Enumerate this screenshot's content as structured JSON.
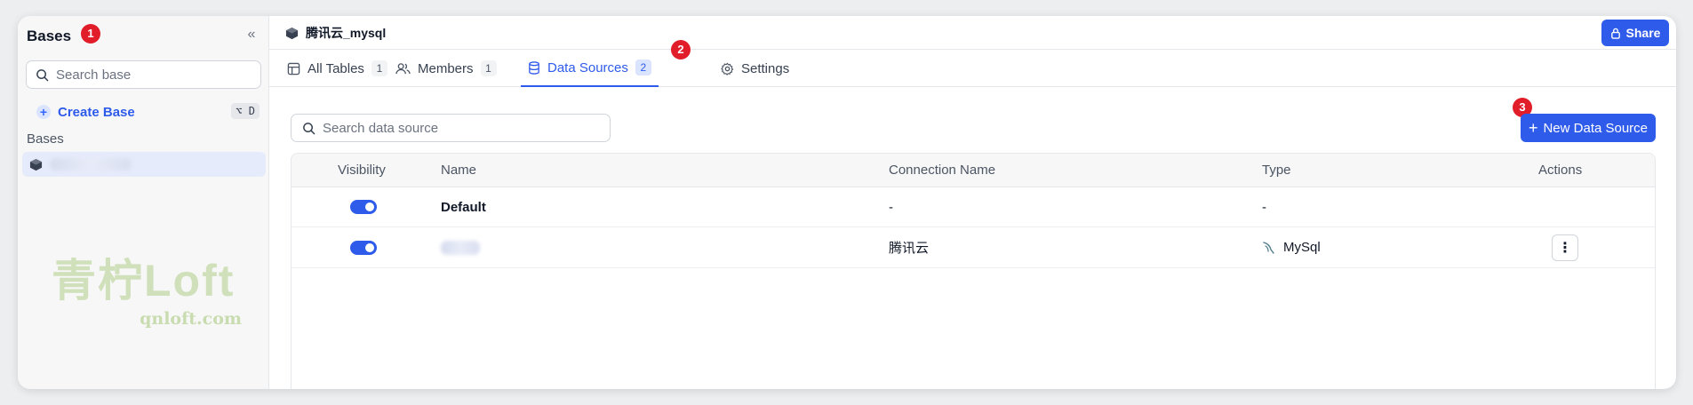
{
  "sidebar": {
    "title": "Bases",
    "search_placeholder": "Search base",
    "create_label": "Create Base",
    "create_shortcut": "⌥ D",
    "section_label": "Bases"
  },
  "badges": {
    "b1": "1",
    "b2": "2",
    "b3": "3"
  },
  "header": {
    "base_name": "腾讯云_mysql",
    "share_label": "Share"
  },
  "tabs": [
    {
      "label": "All Tables",
      "count": "1"
    },
    {
      "label": "Members",
      "count": "1"
    },
    {
      "label": "Data Sources",
      "count": "2"
    },
    {
      "label": "Settings"
    }
  ],
  "data_sources": {
    "search_placeholder": "Search data source",
    "new_button_label": "New Data Source",
    "columns": [
      "Visibility",
      "Name",
      "Connection Name",
      "Type",
      "Actions"
    ],
    "rows": [
      {
        "visible": true,
        "name": "Default",
        "connection": "-",
        "type": "-"
      },
      {
        "visible": true,
        "name": "",
        "connection": "腾讯云",
        "type": "MySql"
      }
    ]
  },
  "watermark": {
    "main": "青柠Loft",
    "sub": "qnloft.com"
  },
  "colors": {
    "accent": "#2f5bea",
    "badge": "#e11d2a",
    "sidebar_bg": "#f7f7f8"
  }
}
